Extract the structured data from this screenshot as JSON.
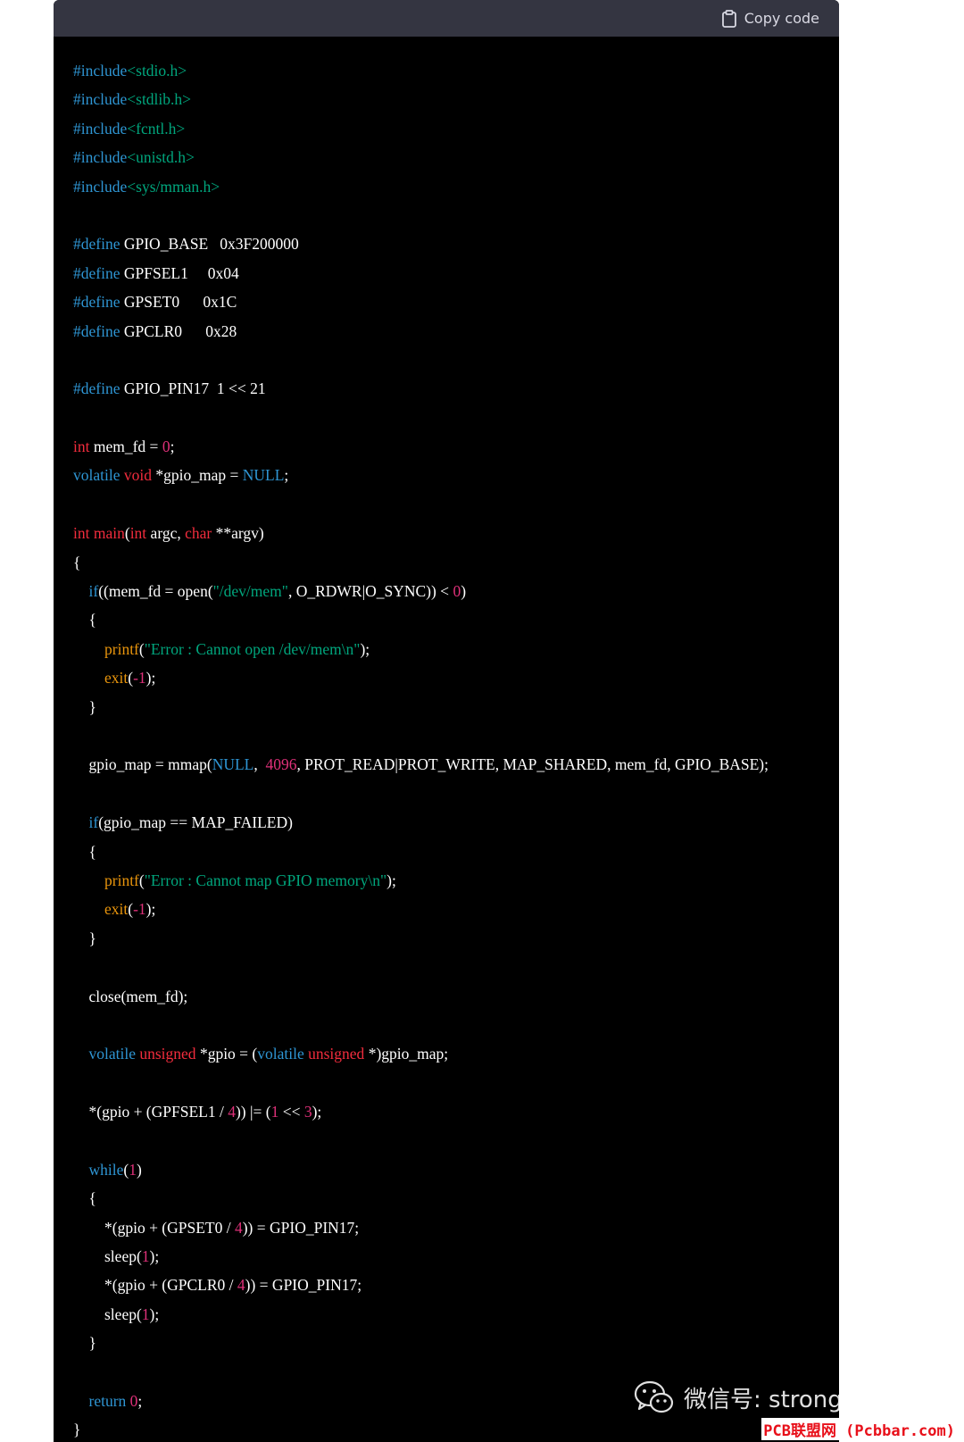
{
  "header": {
    "copy_label": "Copy code",
    "copy_icon": "clipboard-icon"
  },
  "code_lines": [
    [
      [
        "kw",
        "#include"
      ],
      [
        "st",
        "<stdio.h>"
      ]
    ],
    [
      [
        "kw",
        "#include"
      ],
      [
        "st",
        "<stdlib.h>"
      ]
    ],
    [
      [
        "kw",
        "#include"
      ],
      [
        "st",
        "<fcntl.h>"
      ]
    ],
    [
      [
        "kw",
        "#include"
      ],
      [
        "st",
        "<unistd.h>"
      ]
    ],
    [
      [
        "kw",
        "#include"
      ],
      [
        "st",
        "<sys/mman.h>"
      ]
    ],
    [],
    [
      [
        "kw",
        "#define"
      ],
      [
        "pl",
        " GPIO_BASE   0x3F200000"
      ]
    ],
    [
      [
        "kw",
        "#define"
      ],
      [
        "pl",
        " GPFSEL1     0x04"
      ]
    ],
    [
      [
        "kw",
        "#define"
      ],
      [
        "pl",
        " GPSET0      0x1C"
      ]
    ],
    [
      [
        "kw",
        "#define"
      ],
      [
        "pl",
        " GPCLR0      0x28"
      ]
    ],
    [],
    [
      [
        "kw",
        "#define"
      ],
      [
        "pl",
        " GPIO_PIN17  1 << 21"
      ]
    ],
    [],
    [
      [
        "ty",
        "int"
      ],
      [
        "pl",
        " mem_fd = "
      ],
      [
        "nu",
        "0"
      ],
      [
        "pl",
        ";"
      ]
    ],
    [
      [
        "kw",
        "volatile"
      ],
      [
        "pl",
        " "
      ],
      [
        "ty",
        "void"
      ],
      [
        "pl",
        " *gpio_map = "
      ],
      [
        "kw",
        "NULL"
      ],
      [
        "pl",
        ";"
      ]
    ],
    [],
    [
      [
        "ty",
        "int"
      ],
      [
        "pl",
        " "
      ],
      [
        "ty",
        "main"
      ],
      [
        "pl",
        "("
      ],
      [
        "ty",
        "int"
      ],
      [
        "pl",
        " argc, "
      ],
      [
        "ty",
        "char"
      ],
      [
        "pl",
        " **argv)"
      ]
    ],
    [
      [
        "pl",
        "{"
      ]
    ],
    [
      [
        "pl",
        "    "
      ],
      [
        "kw",
        "if"
      ],
      [
        "pl",
        "((mem_fd = open("
      ],
      [
        "st",
        "\"/dev/mem\""
      ],
      [
        "pl",
        ", O_RDWR|O_SYNC)) < "
      ],
      [
        "nu",
        "0"
      ],
      [
        "pl",
        ")"
      ]
    ],
    [
      [
        "pl",
        "    {"
      ]
    ],
    [
      [
        "pl",
        "        "
      ],
      [
        "fn",
        "printf"
      ],
      [
        "pl",
        "("
      ],
      [
        "st",
        "\"Error : Cannot open /dev/mem\\n\""
      ],
      [
        "pl",
        ");"
      ]
    ],
    [
      [
        "pl",
        "        "
      ],
      [
        "fn",
        "exit"
      ],
      [
        "pl",
        "("
      ],
      [
        "nu",
        "-1"
      ],
      [
        "pl",
        ");"
      ]
    ],
    [
      [
        "pl",
        "    }"
      ]
    ],
    [],
    [
      [
        "pl",
        "    gpio_map = mmap("
      ],
      [
        "kw",
        "NULL"
      ],
      [
        "pl",
        ",  "
      ],
      [
        "nu",
        "4096"
      ],
      [
        "pl",
        ", PROT_READ|PROT_WRITE, MAP_SHARED, mem_fd, GPIO_BASE);"
      ]
    ],
    [],
    [
      [
        "pl",
        "    "
      ],
      [
        "kw",
        "if"
      ],
      [
        "pl",
        "(gpio_map == MAP_FAILED)"
      ]
    ],
    [
      [
        "pl",
        "    {"
      ]
    ],
    [
      [
        "pl",
        "        "
      ],
      [
        "fn",
        "printf"
      ],
      [
        "pl",
        "("
      ],
      [
        "st",
        "\"Error : Cannot map GPIO memory\\n\""
      ],
      [
        "pl",
        ");"
      ]
    ],
    [
      [
        "pl",
        "        "
      ],
      [
        "fn",
        "exit"
      ],
      [
        "pl",
        "("
      ],
      [
        "nu",
        "-1"
      ],
      [
        "pl",
        ");"
      ]
    ],
    [
      [
        "pl",
        "    }"
      ]
    ],
    [],
    [
      [
        "pl",
        "    close(mem_fd);"
      ]
    ],
    [],
    [
      [
        "pl",
        "    "
      ],
      [
        "kw",
        "volatile"
      ],
      [
        "pl",
        " "
      ],
      [
        "ty",
        "unsigned"
      ],
      [
        "pl",
        " *gpio = ("
      ],
      [
        "kw",
        "volatile"
      ],
      [
        "pl",
        " "
      ],
      [
        "ty",
        "unsigned"
      ],
      [
        "pl",
        " *)gpio_map;"
      ]
    ],
    [],
    [
      [
        "pl",
        "    *(gpio + (GPFSEL1 / "
      ],
      [
        "nu",
        "4"
      ],
      [
        "pl",
        ")) |= ("
      ],
      [
        "nu",
        "1"
      ],
      [
        "pl",
        " << "
      ],
      [
        "nu",
        "3"
      ],
      [
        "pl",
        ");"
      ]
    ],
    [],
    [
      [
        "pl",
        "    "
      ],
      [
        "kw",
        "while"
      ],
      [
        "pl",
        "("
      ],
      [
        "nu",
        "1"
      ],
      [
        "pl",
        ")"
      ]
    ],
    [
      [
        "pl",
        "    {"
      ]
    ],
    [
      [
        "pl",
        "        *(gpio + (GPSET0 / "
      ],
      [
        "nu",
        "4"
      ],
      [
        "pl",
        ")) = GPIO_PIN17;"
      ]
    ],
    [
      [
        "pl",
        "        sleep("
      ],
      [
        "nu",
        "1"
      ],
      [
        "pl",
        ");"
      ]
    ],
    [
      [
        "pl",
        "        *(gpio + (GPCLR0 / "
      ],
      [
        "nu",
        "4"
      ],
      [
        "pl",
        ")) = GPIO_PIN17;"
      ]
    ],
    [
      [
        "pl",
        "        sleep("
      ],
      [
        "nu",
        "1"
      ],
      [
        "pl",
        ");"
      ]
    ],
    [
      [
        "pl",
        "    }"
      ]
    ],
    [],
    [
      [
        "pl",
        "    "
      ],
      [
        "kw",
        "return"
      ],
      [
        "pl",
        " "
      ],
      [
        "nu",
        "0"
      ],
      [
        "pl",
        ";"
      ]
    ],
    [
      [
        "pl",
        "}"
      ]
    ]
  ],
  "watermark": {
    "text": "微信号: strongerHuang",
    "icon": "wechat-icon"
  },
  "site_mark": {
    "text": "PCB联盟网 (Pcbbar.com)"
  },
  "colors": {
    "header_bg": "#343541",
    "code_bg": "#000000",
    "keyword": "#2e95d3",
    "type": "#f22c3d",
    "string": "#00a67d",
    "number": "#df3079",
    "function": "#e9950c"
  }
}
